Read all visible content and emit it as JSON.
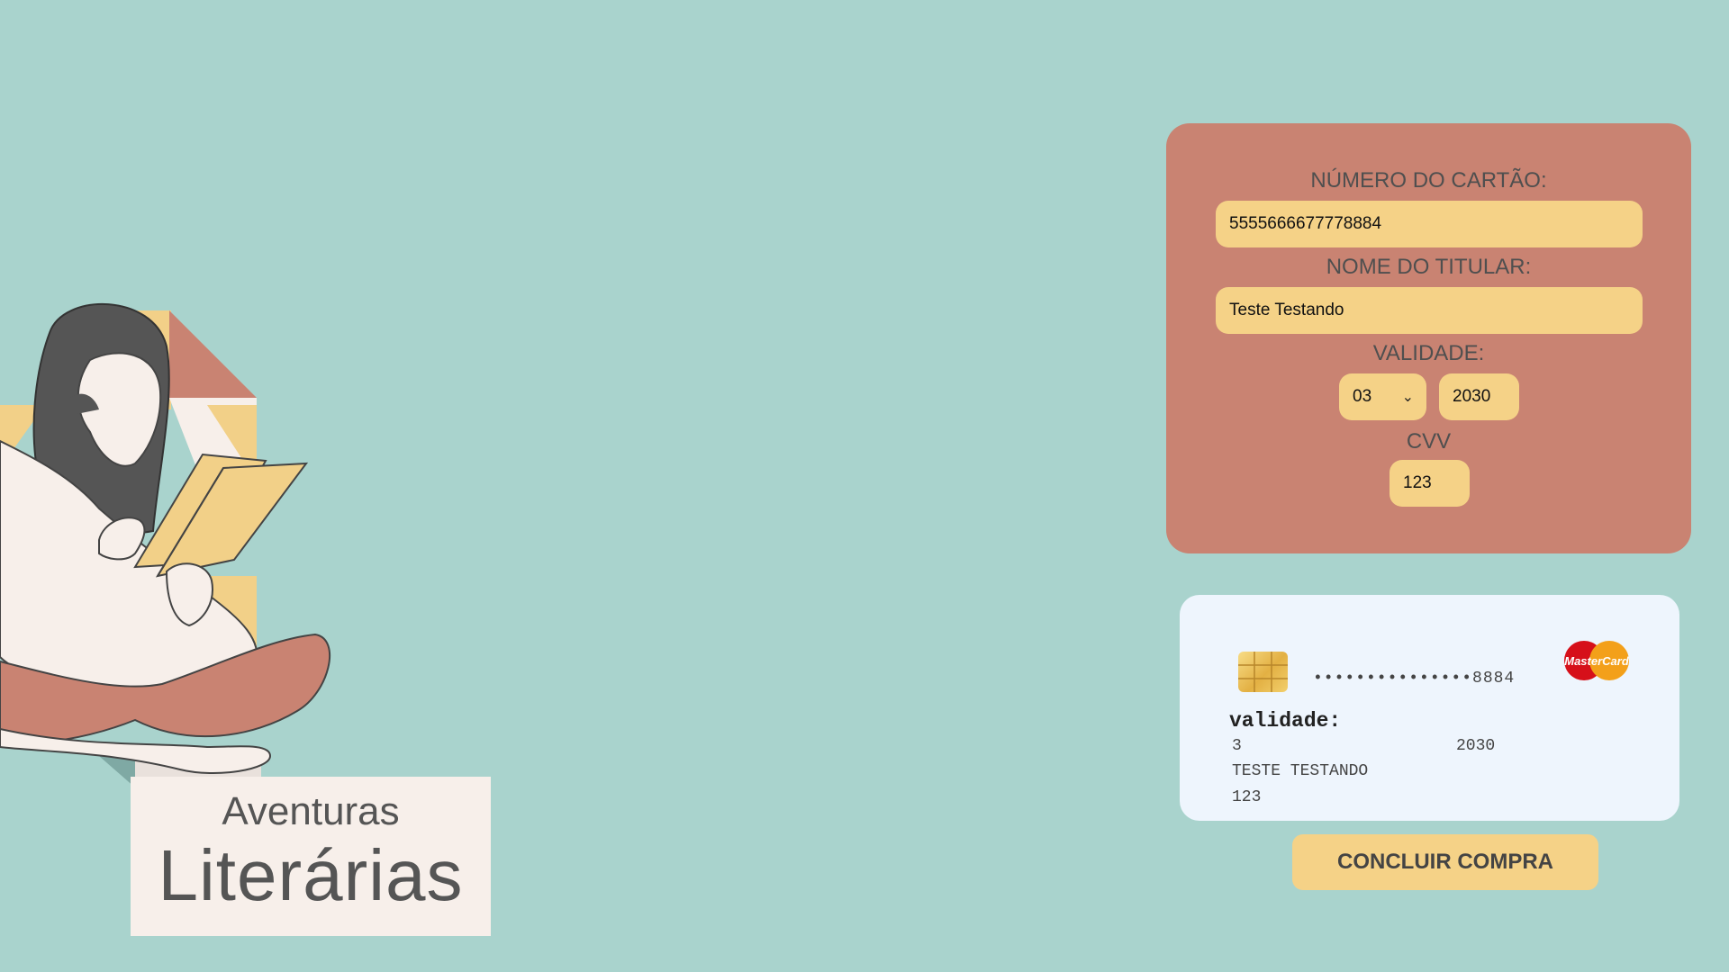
{
  "brand": {
    "line1": "Aventuras",
    "line2": "Literárias"
  },
  "form": {
    "card_number": {
      "label": "NÚMERO DO CARTÃO:",
      "value": "5555666677778884"
    },
    "holder_name": {
      "label": "NOME DO TITULAR:",
      "value": "Teste Testando"
    },
    "expiry": {
      "label": "VALIDADE:",
      "month": "03",
      "year": "2030"
    },
    "cvv": {
      "label": "CVV",
      "value": "123"
    }
  },
  "card_preview": {
    "masked_number": "•••••••••••••••8884",
    "brand_logo": "mastercard-logo",
    "brand_logo_text": "MasterCard",
    "validity_label": "validade:",
    "month": "3",
    "year": "2030",
    "holder": "TESTE TESTANDO",
    "cvv": "123"
  },
  "actions": {
    "checkout_label": "CONCLUIR COMPRA"
  },
  "colors": {
    "background": "#a9d3cd",
    "panel": "#c98372",
    "input": "#f5d287",
    "card": "#eef5fd",
    "brand_box": "#f7efea"
  }
}
